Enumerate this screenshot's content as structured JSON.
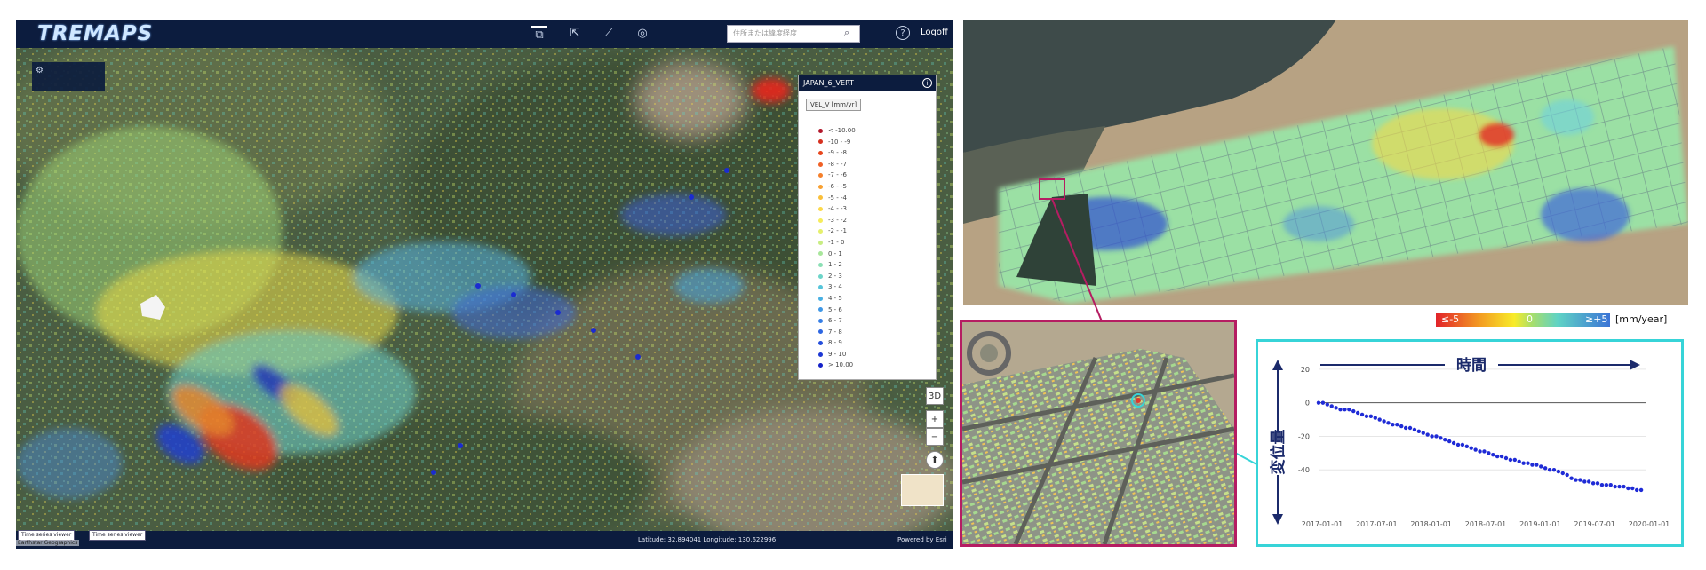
{
  "app": {
    "logo": "TREMAPS",
    "search_placeholder": "住所または緯度経度",
    "logout_label": "Logoff",
    "help_icon": "?",
    "legend": {
      "title": "JAPAN_6_VERT",
      "tab_label": "VEL_V [mm/yr]",
      "items": [
        {
          "label": "< -10.00",
          "color": "#b2182b"
        },
        {
          "label": "-10 - -9",
          "color": "#d6301f"
        },
        {
          "label": "-9 - -8",
          "color": "#e8461c"
        },
        {
          "label": "-8 - -7",
          "color": "#f06025"
        },
        {
          "label": "-7 - -6",
          "color": "#f5802b"
        },
        {
          "label": "-6 - -5",
          "color": "#f8a032"
        },
        {
          "label": "-5 - -4",
          "color": "#fabf3a"
        },
        {
          "label": "-4 - -3",
          "color": "#fcd94a"
        },
        {
          "label": "-3 - -2",
          "color": "#f6ec5b"
        },
        {
          "label": "-2 - -1",
          "color": "#e5f06c"
        },
        {
          "label": "-1 - 0",
          "color": "#c8ed83"
        },
        {
          "label": "0 - 1",
          "color": "#a8e69b"
        },
        {
          "label": "1 - 2",
          "color": "#8adfb4"
        },
        {
          "label": "2 - 3",
          "color": "#6dd5c9"
        },
        {
          "label": "3 - 4",
          "color": "#56c5da"
        },
        {
          "label": "4 - 5",
          "color": "#48b0e3"
        },
        {
          "label": "5 - 6",
          "color": "#3f97e6"
        },
        {
          "label": "6 - 7",
          "color": "#367ee5"
        },
        {
          "label": "7 - 8",
          "color": "#2d66e2"
        },
        {
          "label": "8 - 9",
          "color": "#244edc"
        },
        {
          "label": "9 - 10",
          "color": "#1c37d4"
        },
        {
          "label": "> 10.00",
          "color": "#1421c8"
        }
      ]
    },
    "controls": {
      "view3d": "3D",
      "zoom_in": "+",
      "zoom_out": "−"
    },
    "timeseries_tabs": [
      "Time series viewer",
      "Time series viewer"
    ],
    "coords": "Latitude: 32.894041  Longitude: 130.622996",
    "powered": "Powered by Esri",
    "copyright": "Earthstar Geographics"
  },
  "scale": {
    "min": "≤-5",
    "mid": "0",
    "max": "≥+5",
    "unit": "[mm/year]"
  },
  "colors": {
    "accent_magenta": "#b51d62",
    "accent_cyan": "#37d4d8",
    "navy": "#0c1c3e",
    "chart_title": "#1b2a6b",
    "points": "#1f2bd6"
  },
  "chart_data": {
    "type": "scatter",
    "title": "時間",
    "ylabel": "変位量",
    "yticks": [
      20,
      0,
      -20,
      -40
    ],
    "ylim": [
      -60,
      30
    ],
    "xlabels": [
      "2017-01-01",
      "2017-07-01",
      "2018-01-01",
      "2018-07-01",
      "2019-01-01",
      "2019-07-01",
      "2020-01-01"
    ],
    "x": [
      0,
      0.04,
      0.08,
      0.12,
      0.16,
      0.2,
      0.24,
      0.28,
      0.32,
      0.36,
      0.4,
      0.44,
      0.48,
      0.52,
      0.56,
      0.6,
      0.64,
      0.68,
      0.72,
      0.76,
      0.8,
      0.84,
      0.88,
      0.92,
      0.96,
      1.0,
      1.04,
      1.08,
      1.12,
      1.16,
      1.2,
      1.24,
      1.28,
      1.32,
      1.36,
      1.4,
      1.44,
      1.48,
      1.52,
      1.56,
      1.6,
      1.64,
      1.68,
      1.72,
      1.76,
      1.8,
      1.84,
      1.88,
      1.92,
      1.96,
      2.0,
      2.04,
      2.08,
      2.12,
      2.16,
      2.2,
      2.24,
      2.28,
      2.32,
      2.36,
      2.4,
      2.44,
      2.48,
      2.52,
      2.56,
      2.6,
      2.64,
      2.68,
      2.72,
      2.76,
      2.8,
      2.84,
      2.88,
      2.92,
      2.96
    ],
    "y": [
      0,
      0,
      -1,
      -2,
      -3,
      -4,
      -4,
      -4,
      -5,
      -6,
      -7,
      -8,
      -8,
      -9,
      -10,
      -11,
      -12,
      -13,
      -13,
      -14,
      -15,
      -15,
      -16,
      -17,
      -18,
      -19,
      -20,
      -20,
      -21,
      -22,
      -23,
      -24,
      -25,
      -25,
      -26,
      -27,
      -28,
      -29,
      -29,
      -30,
      -31,
      -32,
      -32,
      -33,
      -34,
      -34,
      -35,
      -36,
      -36,
      -37,
      -37,
      -38,
      -39,
      -40,
      -40,
      -41,
      -42,
      -43,
      -45,
      -46,
      -46,
      -47,
      -47,
      -48,
      -48,
      -49,
      -49,
      -49,
      -50,
      -50,
      -50,
      -51,
      -51,
      -52,
      -52
    ]
  }
}
